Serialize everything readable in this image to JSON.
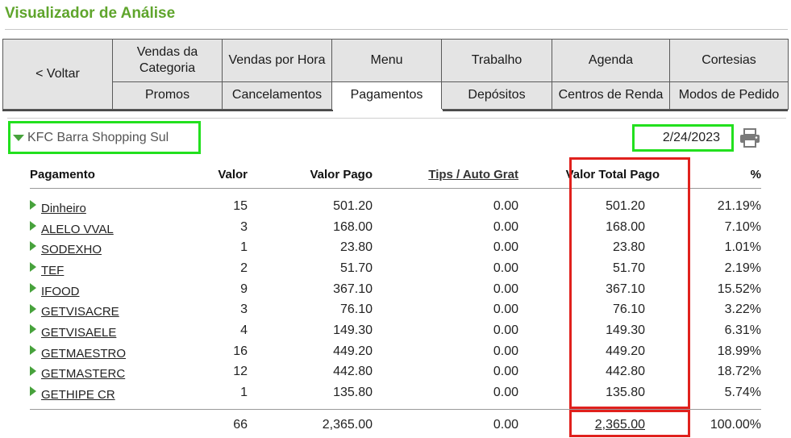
{
  "page": {
    "title": "Visualizador de Análise"
  },
  "nav": {
    "back_label": "< Voltar",
    "row1": [
      "Vendas da Categoria",
      "Vendas por Hora",
      "Menu",
      "Trabalho",
      "Agenda",
      "Cortesias"
    ],
    "row2": [
      "Promos",
      "Cancelamentos",
      "Pagamentos",
      "Depósitos",
      "Centros de Renda",
      "Modos de Pedido"
    ],
    "active_tab": "Pagamentos"
  },
  "store": {
    "name": "KFC Barra Shopping Sul",
    "date": "2/24/2023"
  },
  "icons": {
    "expand": "triangle-down-icon",
    "row_expand": "triangle-right-icon",
    "print": "printer-icon"
  },
  "colors": {
    "title": "#5fa52c",
    "highlight_green": "#22e01e",
    "highlight_red": "#e0211d",
    "arrow": "#47a23c"
  },
  "table": {
    "headers": {
      "payment": "Pagamento",
      "count": "Valor",
      "paid": "Valor Pago",
      "tips": "Tips / Auto Grat",
      "total_paid": "Valor Total Pago",
      "percent": "%"
    },
    "rows": [
      {
        "name": "Dinheiro",
        "count": "15",
        "paid": "501.20",
        "tips": "0.00",
        "total": "501.20",
        "pct": "21.19%"
      },
      {
        "name": "ALELO VVAL",
        "count": "3",
        "paid": "168.00",
        "tips": "0.00",
        "total": "168.00",
        "pct": "7.10%"
      },
      {
        "name": "SODEXHO",
        "count": "1",
        "paid": "23.80",
        "tips": "0.00",
        "total": "23.80",
        "pct": "1.01%"
      },
      {
        "name": "TEF",
        "count": "2",
        "paid": "51.70",
        "tips": "0.00",
        "total": "51.70",
        "pct": "2.19%"
      },
      {
        "name": "IFOOD",
        "count": "9",
        "paid": "367.10",
        "tips": "0.00",
        "total": "367.10",
        "pct": "15.52%"
      },
      {
        "name": "GETVISACRE",
        "count": "3",
        "paid": "76.10",
        "tips": "0.00",
        "total": "76.10",
        "pct": "3.22%"
      },
      {
        "name": "GETVISAELE",
        "count": "4",
        "paid": "149.30",
        "tips": "0.00",
        "total": "149.30",
        "pct": "6.31%"
      },
      {
        "name": "GETMAESTRO",
        "count": "16",
        "paid": "449.20",
        "tips": "0.00",
        "total": "449.20",
        "pct": "18.99%"
      },
      {
        "name": "GETMASTERC",
        "count": "12",
        "paid": "442.80",
        "tips": "0.00",
        "total": "442.80",
        "pct": "18.72%"
      },
      {
        "name": "GETHIPE CR",
        "count": "1",
        "paid": "135.80",
        "tips": "0.00",
        "total": "135.80",
        "pct": "5.74%"
      }
    ],
    "totals": {
      "count": "66",
      "paid": "2,365.00",
      "tips": "0.00",
      "total": "2,365.00",
      "pct": "100.00%"
    }
  }
}
